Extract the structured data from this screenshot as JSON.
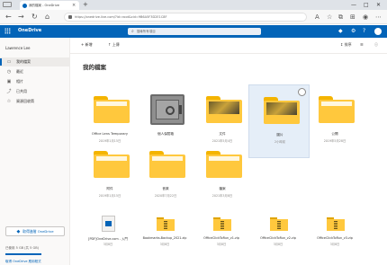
{
  "browser": {
    "tab_title": "我的檔案 - OneDrive",
    "tab_close": "×",
    "new_tab": "+",
    "window_controls": [
      "—",
      "□",
      "✕"
    ],
    "url": "https://onedrive.live.com/?id=root&cid=9B6A5F3D2E1C8F",
    "nav_icons": [
      "back-icon",
      "forward-icon",
      "refresh-icon",
      "home-icon"
    ],
    "tool_icons": [
      "reading-view-icon",
      "favorite-icon",
      "collections-icon",
      "extensions-icon",
      "profile-icon",
      "more-icon"
    ]
  },
  "onedrive": {
    "brand": "OneDrive",
    "search_placeholder": "搜尋所有項目",
    "header_icons": [
      "premium-diamond-icon",
      "settings-icon",
      "help-icon"
    ]
  },
  "sidebar": {
    "user": "Lawrence Lee",
    "items": [
      {
        "label": "我的檔案",
        "icon": "folder-icon",
        "active": true
      },
      {
        "label": "最近",
        "icon": "clock-icon",
        "active": false
      },
      {
        "label": "相片",
        "icon": "photo-icon",
        "active": false
      },
      {
        "label": "已共用",
        "icon": "share-icon",
        "active": false
      },
      {
        "label": "資源回收筒",
        "icon": "recycle-bin-icon",
        "active": false
      }
    ],
    "premium_label": "取得進階 OneDrive",
    "storage_text": "已使用 5 GB (共 5 GB)",
    "storage_fraction": 0.99,
    "get_apps": "取得 OneDrive 應用程式"
  },
  "commandbar": {
    "new_label": "+ 新增",
    "upload_label": "↑ 上傳",
    "sort_label": "↕ 排序",
    "view_label": "☰",
    "info_label": "ⓘ"
  },
  "main": {
    "title": "我的檔案",
    "folders": [
      {
        "name": "Office Lens Temporary",
        "meta": "2019年1月15日",
        "kind": "folder",
        "selected": false
      },
      {
        "name": "個人保險箱",
        "meta": "",
        "kind": "vault",
        "selected": false
      },
      {
        "name": "文件",
        "meta": "2021年5月4日",
        "kind": "thumb-folder",
        "selected": false
      },
      {
        "name": "圖片",
        "meta": "2小時前",
        "kind": "thumb-folder",
        "selected": true
      },
      {
        "name": "公開",
        "meta": "2019年5月28日",
        "kind": "folder",
        "selected": false
      },
      {
        "name": "附件",
        "meta": "2019年1月15日",
        "kind": "folder",
        "selected": false
      },
      {
        "name": "音樂",
        "meta": "2020年7月22日",
        "kind": "folder",
        "selected": false
      },
      {
        "name": "檔案",
        "meta": "2021年3月8日",
        "kind": "folder",
        "selected": false
      }
    ],
    "files": [
      {
        "name": "[PDF]OneDrive.com - 入門",
        "meta": "3月8日",
        "kind": "doc"
      },
      {
        "name": "Bookmarks-Backup_2021.zip",
        "meta": "3月8日",
        "kind": "zip"
      },
      {
        "name": "OfficeClickToRun_v1.zip",
        "meta": "3月8日",
        "kind": "zip"
      },
      {
        "name": "OfficeClickToRun_v2.zip",
        "meta": "3月8日",
        "kind": "zip"
      },
      {
        "name": "OfficeClickToRun_v3.zip",
        "meta": "3月8日",
        "kind": "zip"
      }
    ]
  },
  "colors": {
    "brand_blue": "#0364b8",
    "folder_yellow": "#ffc83d",
    "selection": "#e5eef8"
  }
}
